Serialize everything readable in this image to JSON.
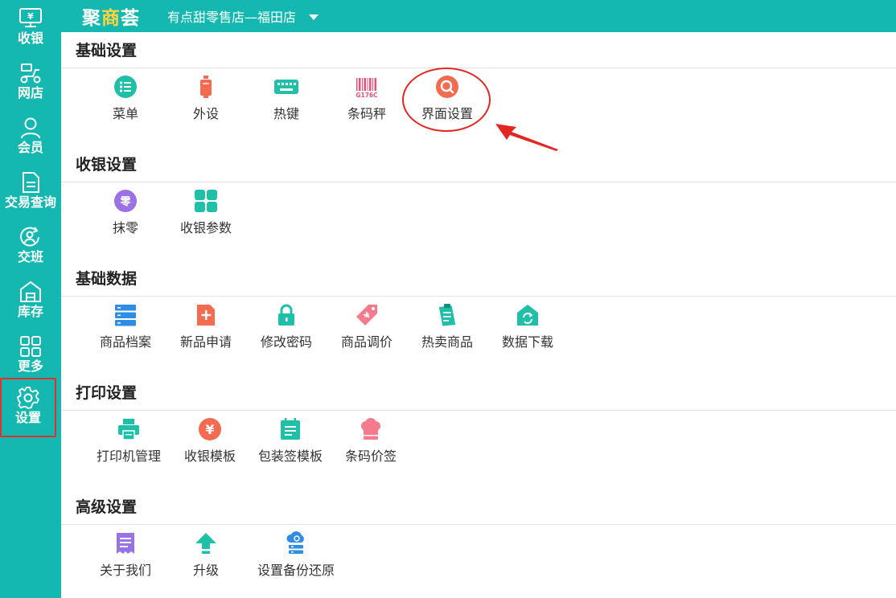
{
  "header": {
    "logo_text_a": "聚",
    "logo_text_b": "商",
    "logo_text_c": "荟",
    "store_name": "有点甜零售店—福田店",
    "store_dropdown_icon": "caret-down-icon"
  },
  "sidebar": {
    "items": [
      {
        "label": "收银",
        "icon": "cashier-icon"
      },
      {
        "label": "网店",
        "icon": "scooter-icon"
      },
      {
        "label": "会员",
        "icon": "user-icon"
      },
      {
        "label": "交易查询",
        "icon": "document-icon"
      },
      {
        "label": "交班",
        "icon": "shift-icon"
      },
      {
        "label": "库存",
        "icon": "warehouse-icon"
      },
      {
        "label": "更多",
        "icon": "grid-icon"
      },
      {
        "label": "设置",
        "icon": "gear-icon",
        "active": true
      }
    ]
  },
  "sections": [
    {
      "title": "基础设置",
      "items": [
        {
          "label": "菜单",
          "icon": "menu-icon",
          "color": "#1fbfa8"
        },
        {
          "label": "外设",
          "icon": "peripheral-icon",
          "color": "#f56b4f"
        },
        {
          "label": "热键",
          "icon": "keyboard-icon",
          "color": "#1fbfa8"
        },
        {
          "label": "条码秤",
          "icon": "barcode-icon",
          "color": "#e8507a",
          "icon_text": "G176C"
        },
        {
          "label": "界面设置",
          "icon": "search-icon",
          "color": "#f56b4f"
        }
      ]
    },
    {
      "title": "收银设置",
      "items": [
        {
          "label": "抹零",
          "icon": "zero-icon",
          "color": "#9a72e6",
          "icon_text": "零"
        },
        {
          "label": "收银参数",
          "icon": "grid-icon",
          "color": "#1fbfa8"
        }
      ]
    },
    {
      "title": "基础数据",
      "items": [
        {
          "label": "商品档案",
          "icon": "server-icon",
          "color": "#2f8de4"
        },
        {
          "label": "新品申请",
          "icon": "new-doc-icon",
          "color": "#f56b4f"
        },
        {
          "label": "修改密码",
          "icon": "lock-icon",
          "color": "#1fbfa8"
        },
        {
          "label": "商品调价",
          "icon": "price-tag-icon",
          "color": "#f47a8c"
        },
        {
          "label": "热卖商品",
          "icon": "clipboard-icon",
          "color": "#1fbfa8"
        },
        {
          "label": "数据下载",
          "icon": "sync-home-icon",
          "color": "#1fbfa8"
        }
      ]
    },
    {
      "title": "打印设置",
      "items": [
        {
          "label": "打印机管理",
          "icon": "printer-icon",
          "color": "#1fbfa8"
        },
        {
          "label": "收银模板",
          "icon": "yen-icon",
          "color": "#f56b4f",
          "icon_text": "¥"
        },
        {
          "label": "包装签模板",
          "icon": "calendar-icon",
          "color": "#1fbfa8"
        },
        {
          "label": "条码价签",
          "icon": "chef-hat-icon",
          "color": "#f47a8c"
        }
      ]
    },
    {
      "title": "高级设置",
      "items": [
        {
          "label": "关于我们",
          "icon": "receipt-icon",
          "color": "#9a72e6"
        },
        {
          "label": "升级",
          "icon": "upload-icon",
          "color": "#1fbfa8"
        },
        {
          "label": "设置备份还原",
          "icon": "cloud-backup-icon",
          "color": "#2f8de4"
        }
      ]
    }
  ],
  "colors": {
    "brand": "#14b8b0",
    "annotation": "#e32620"
  }
}
